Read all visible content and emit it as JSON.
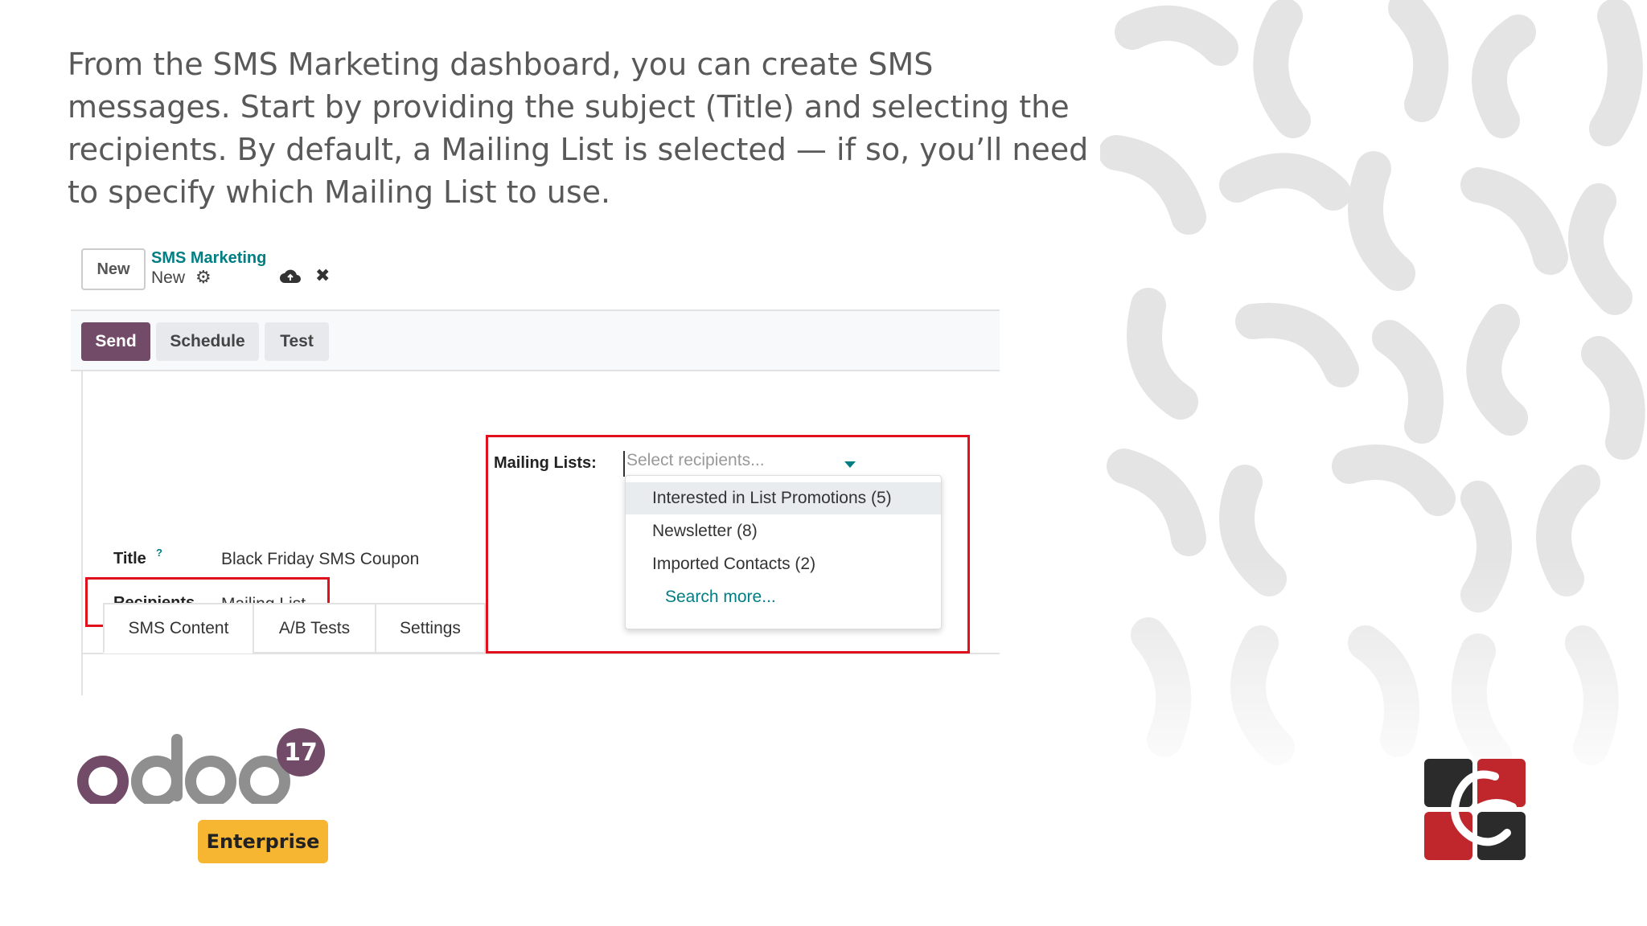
{
  "slide": {
    "intro_text": "From the SMS Marketing dashboard, you can create SMS messages. Start by providing the subject (Title) and selecting the recipients. By default, a Mailing List is selected — if so, you’ll need to specify which Mailing List to use."
  },
  "control_panel": {
    "new_button": "New",
    "breadcrumb_app": "SMS Marketing",
    "breadcrumb_record": "New",
    "icons": [
      "gear-icon",
      "cloud-upload-icon",
      "close-icon"
    ]
  },
  "status_bar": {
    "send": "Send",
    "schedule": "Schedule",
    "test": "Test"
  },
  "form": {
    "title_label": "Title",
    "title_help": "?",
    "title_value": "Black Friday SMS Coupon",
    "recipients_label": "Recipients",
    "recipients_value": "Mailing List",
    "mailing_lists_label": "Mailing Lists:",
    "mailing_lists_placeholder": "Select recipients..."
  },
  "tabs": [
    {
      "label": "SMS Content",
      "active": true
    },
    {
      "label": "A/B Tests",
      "active": false
    },
    {
      "label": "Settings",
      "active": false
    }
  ],
  "dropdown": {
    "items": [
      {
        "label": "Interested in List Promotions (5)",
        "highlighted": true
      },
      {
        "label": "Newsletter (8)",
        "highlighted": false
      },
      {
        "label": "Imported Contacts (2)",
        "highlighted": false
      }
    ],
    "search_more": "Search more..."
  },
  "branding": {
    "version": "17",
    "edition": "Enterprise"
  },
  "colors": {
    "primary": "#714b67",
    "accent": "#017e84",
    "highlight_box": "#e0101d",
    "enterprise_badge": "#f6b632"
  }
}
